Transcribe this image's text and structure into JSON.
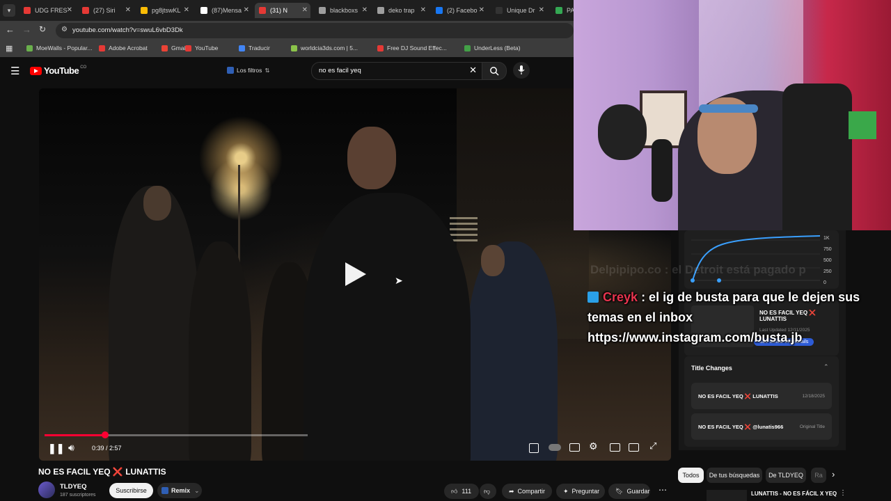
{
  "browser": {
    "tabs": [
      {
        "label": "UDG FRES",
        "color": "#e53935"
      },
      {
        "label": "(27) Siri",
        "color": "#e53935"
      },
      {
        "label": "pg8jtswKL",
        "color": "#fbbc05"
      },
      {
        "label": "(87)Mensa",
        "color": "#ffffff"
      },
      {
        "label": "(31) N",
        "color": "#e53935"
      },
      {
        "label": "blackboxs",
        "color": "#9e9e9e"
      },
      {
        "label": "deko trap",
        "color": "#9e9e9e"
      },
      {
        "label": "(2) Facebo",
        "color": "#1877f2"
      },
      {
        "label": "Unique Dr",
        "color": "#333333"
      },
      {
        "label": "PA",
        "color": "#34a853"
      }
    ],
    "url": "youtube.com/watch?v=swuL6vbD3Dk",
    "bookmarks": [
      {
        "label": "MoeWalls - Popular...",
        "color": "#6ab04c"
      },
      {
        "label": "Adobe Acrobat",
        "color": "#e53935"
      },
      {
        "label": "Gmail",
        "color": "#ea4335"
      },
      {
        "label": "YouTube",
        "color": "#e53935"
      },
      {
        "label": "Traducir",
        "color": "#4285f4"
      },
      {
        "label": "worldcia3ds.com | 5...",
        "color": "#8bc34a"
      },
      {
        "label": "Free DJ Sound Effec...",
        "color": "#e53935"
      },
      {
        "label": "UnderLess (Beta)",
        "color": "#43a047"
      }
    ]
  },
  "youtube": {
    "logo_text": "YouTube",
    "region": "CO",
    "filters_label": "Los filtros",
    "search_value": "no es facil yeq"
  },
  "player": {
    "time": "0:39 / 2:57",
    "progress_fraction": 0.23
  },
  "video": {
    "title": "NO ES FACIL YEQ ❌ LUNATTIS",
    "channel": "TLDYEQ",
    "subscribers": "187 suscriptores",
    "subscribe_label": "Suscribirse",
    "remix_label": "Remix",
    "likes": "111",
    "share_label": "Compartir",
    "ask_label": "Preguntar",
    "save_label": "Guardar"
  },
  "overlay": {
    "faded_text": "Delpipipo.co : el Detroit está pagado p",
    "chat_user": "Creyk",
    "chat_user_color": "#e8344e",
    "chat_message_line1": ": el ig de busta para que le dejen sus",
    "chat_message_line2": "temas en el inbox",
    "chat_message_line3": "https://www.instagram.com/busta.jb"
  },
  "panel": {
    "chart_ticks": [
      "1K",
      "750",
      "500",
      "250",
      "0"
    ],
    "thumb_title": "NO ES FACIL YEQ ❌ LUNATTIS",
    "thumb_date": "Last Updated 12/11/2025",
    "similar_label": "See similar thumbnails",
    "title_changes_label": "Title Changes",
    "changes": [
      {
        "title": "NO ES FACIL YEQ ❌ LUNATTIS",
        "meta": "12/18/2025"
      },
      {
        "title": "NO ES FACIL YEQ ❌ @lunatis966",
        "meta": "Original Title"
      }
    ]
  },
  "chips": [
    "Todos",
    "De tus búsquedas",
    "De TLDYEQ",
    "Ra"
  ],
  "related": {
    "title": "LUNATTIS - NO ES FÁCIL X YEQ"
  }
}
